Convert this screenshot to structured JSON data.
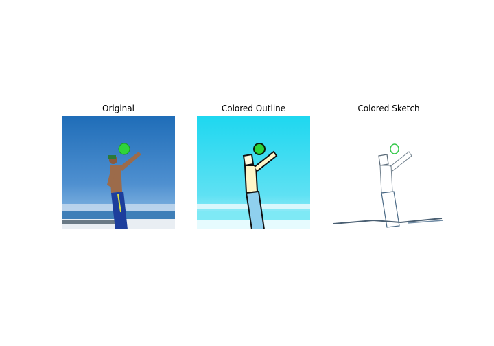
{
  "figure": {
    "panels": [
      {
        "title": "Original"
      },
      {
        "title": "Colored Outline"
      },
      {
        "title": "Colored Sketch"
      }
    ]
  }
}
